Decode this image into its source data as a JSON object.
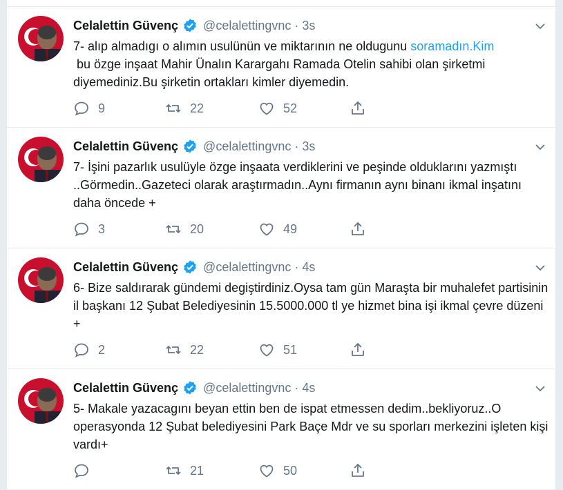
{
  "colors": {
    "accent": "#1da1f2",
    "text": "#14171a",
    "muted": "#657786",
    "border": "#e6ecf0"
  },
  "tweets": [
    {
      "name": "Celalettin Güvenç",
      "handle": "@celalettingvnc",
      "dot": "·",
      "time": "3s",
      "text_before": "7- alıp almadıgı o alımın usulünün ve miktarının ne oldugunu ",
      "link": "soramadın.Kim",
      "text_after": "\n bu özge inşaat Mahir Ünalın Karargahı Ramada Otelin sahibi olan şirketmi diyemediniz.Bu şirketin ortakları kimler diyemedin.",
      "replies": "9",
      "retweets": "22",
      "likes": "52"
    },
    {
      "name": "Celalettin Güvenç",
      "handle": "@celalettingvnc",
      "dot": "·",
      "time": "3s",
      "text_before": "7- İşini pazarlık usulüyle özge inşaata verdiklerini ve peşinde olduklarını yazmıştı ..Görmedin..Gazeteci olarak araştırmadın..Aynı firmanın aynı binanı ikmal inşatını daha öncede +",
      "link": "",
      "text_after": "",
      "replies": "3",
      "retweets": "20",
      "likes": "49"
    },
    {
      "name": "Celalettin Güvenç",
      "handle": "@celalettingvnc",
      "dot": "·",
      "time": "4s",
      "text_before": "6- Bize saldırarak gündemi degiştirdiniz.Oysa tam gün Maraşta bir muhalefet partisinin il başkanı 12 Şubat Belediyesinin 15.5000.000 tl ye hizmet bina işi ikmal çevre düzeni +",
      "link": "",
      "text_after": "",
      "replies": "2",
      "retweets": "22",
      "likes": "51"
    },
    {
      "name": "Celalettin Güvenç",
      "handle": "@celalettingvnc",
      "dot": "·",
      "time": "4s",
      "text_before": "5- Makale yazacagını beyan ettin ben de ispat etmessen dedim..bekliyoruz..O operasyonda 12 Şubat belediyesini Park Baçe Mdr ve su sporları merkezini işleten kişi vardı+",
      "link": "",
      "text_after": "",
      "replies": "",
      "retweets": "21",
      "likes": "50"
    }
  ]
}
